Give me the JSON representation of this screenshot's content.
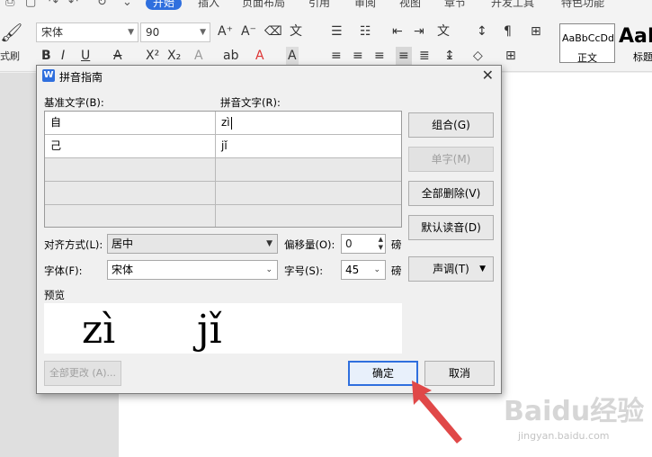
{
  "ribbon": {
    "tabs": [
      "开始",
      "插入",
      "页面布局",
      "引用",
      "审阅",
      "视图",
      "章节",
      "开发工具",
      "特色功能"
    ],
    "active_tab": "开始",
    "font_name": "宋体",
    "font_size": "90",
    "format_painter_label": "式刷",
    "styles": [
      {
        "sample": "AaBbCcDd",
        "name": "正文"
      },
      {
        "sample": "AaB",
        "name": "标题"
      }
    ]
  },
  "dialog": {
    "title": "拼音指南",
    "base_text_label": "基准文字(B):",
    "pinyin_label": "拼音文字(R):",
    "rows": [
      {
        "base": "自",
        "pinyin": "zì"
      },
      {
        "base": "己",
        "pinyin": "jǐ"
      },
      {
        "base": "",
        "pinyin": ""
      },
      {
        "base": "",
        "pinyin": ""
      },
      {
        "base": "",
        "pinyin": ""
      }
    ],
    "buttons": {
      "group": "组合(G)",
      "single": "单字(M)",
      "clear_all": "全部删除(V)",
      "default_reading": "默认读音(D)",
      "tone": "声调(T)",
      "change_all": "全部更改 (A)...",
      "ok": "确定",
      "cancel": "取消"
    },
    "align_label": "对齐方式(L):",
    "align_value": "居中",
    "offset_label": "偏移量(O):",
    "offset_value": "0",
    "offset_unit": "磅",
    "font_label": "字体(F):",
    "font_value": "宋体",
    "size_label": "字号(S):",
    "size_value": "45",
    "size_unit": "磅",
    "preview_label": "预览",
    "preview_items": [
      "zì",
      "jǐ"
    ]
  },
  "watermark": {
    "main": "Baidu经验",
    "sub": "jingyan.baidu.com"
  },
  "colors": {
    "accent": "#2f6fde",
    "arrow": "#e04848"
  }
}
